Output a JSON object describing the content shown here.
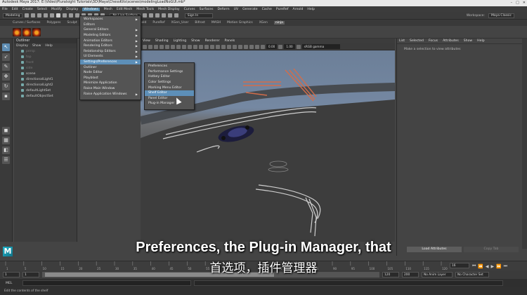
{
  "window": {
    "title": "Autodesk Maya 2017: E:\\Video\\Pluralsight Tutorials\\3D\\Maya\\ChessKits\\scenes\\modelingLoadNoGUI.mb*"
  },
  "menubar": [
    "File",
    "Edit",
    "Create",
    "Select",
    "Modify",
    "Display",
    "Windows",
    "Mesh",
    "Edit Mesh",
    "Mesh Tools",
    "Mesh Display",
    "Curves",
    "Surfaces",
    "Deform",
    "UV",
    "Generate",
    "Cache",
    "PureRef",
    "Arnold",
    "Help"
  ],
  "menubar_active": "Windows",
  "status_line": {
    "mode": "Modeling",
    "live_surface": "No Live Surface",
    "sign_in": "Sign In",
    "workspace_label": "Workspace:",
    "workspace_value": "Maya Classic"
  },
  "shelf_tabs": [
    "Curves / Surfaces",
    "Polygons",
    "Sculpt",
    "FX",
    "FX Caching",
    "Custom",
    "Arnold",
    "PureRef",
    "XGen_User",
    "Bifrost",
    "MASH",
    "Motion Graphics",
    "XGen",
    "ninja"
  ],
  "shelf_tab_active": "ninja",
  "outliner": {
    "title": "Outliner",
    "menu": [
      "Display",
      "Show",
      "Help"
    ],
    "items": [
      {
        "label": "persp",
        "dim": true
      },
      {
        "label": "top",
        "dim": true
      },
      {
        "label": "front",
        "dim": true
      },
      {
        "label": "side",
        "dim": true
      },
      {
        "label": "scene",
        "dim": false
      },
      {
        "label": "directionalLight1",
        "dim": false
      },
      {
        "label": "directionalLight2",
        "dim": false
      },
      {
        "label": "defaultLightSet",
        "dim": false
      },
      {
        "label": "defaultObjectSet",
        "dim": false
      }
    ]
  },
  "windows_menu": {
    "items": [
      {
        "label": "Workspaces",
        "arrow": true,
        "highlight": false
      },
      {
        "label": "Editors",
        "arrow": false,
        "highlight": false
      },
      {
        "label": "General Editors",
        "arrow": true,
        "highlight": false
      },
      {
        "label": "Modeling Editors",
        "arrow": true,
        "highlight": false
      },
      {
        "label": "Animation Editors",
        "arrow": true,
        "highlight": false
      },
      {
        "label": "Rendering Editors",
        "arrow": true,
        "highlight": false
      },
      {
        "label": "Relationship Editors",
        "arrow": true,
        "highlight": false
      },
      {
        "label": "UI Elements",
        "arrow": true,
        "highlight": false
      },
      {
        "label": "Settings/Preferences",
        "arrow": true,
        "highlight": true
      },
      {
        "label": "Outliner",
        "arrow": false,
        "highlight": false
      },
      {
        "label": "Node Editor",
        "arrow": false,
        "highlight": false
      },
      {
        "label": "Playblast",
        "arrow": false,
        "highlight": false
      },
      {
        "label": "Minimize Application",
        "arrow": false,
        "highlight": false
      },
      {
        "label": "Raise Main Window",
        "arrow": false,
        "highlight": false
      },
      {
        "label": "Raise Application Windows",
        "arrow": true,
        "highlight": false
      }
    ]
  },
  "settings_submenu": {
    "items": [
      {
        "label": "Preferences",
        "highlight": false
      },
      {
        "label": "Performance Settings",
        "highlight": false
      },
      {
        "label": "Hotkey Editor",
        "highlight": false
      },
      {
        "label": "Color Settings",
        "highlight": false
      },
      {
        "label": "Marking Menu Editor",
        "highlight": false
      },
      {
        "label": "Shelf Editor",
        "highlight": true
      },
      {
        "label": "Panel Editor",
        "highlight": false
      },
      {
        "label": "Plug-in Manager",
        "highlight": false
      }
    ]
  },
  "viewport": {
    "menu": [
      "View",
      "Shading",
      "Lighting",
      "Show",
      "Renderer",
      "Panels"
    ],
    "value_a": "0.00",
    "value_b": "1.00",
    "color_space": "sRGB gamma"
  },
  "attribute_editor": {
    "menu": [
      "List",
      "Selected",
      "Focus",
      "Attributes",
      "Show",
      "Help"
    ],
    "message": "Make a selection to view attributes",
    "load_button": "Load Attributes",
    "copy_button": "Copy Tab"
  },
  "timeline": {
    "ticks": [
      "1",
      "5",
      "10",
      "15",
      "20",
      "25",
      "30",
      "35",
      "40",
      "45",
      "50",
      "55",
      "60",
      "65",
      "70",
      "75",
      "80",
      "85",
      "90",
      "95",
      "100",
      "105",
      "110",
      "115",
      "120"
    ],
    "current_frame": "16"
  },
  "range": {
    "start": "1",
    "start_inner": "1",
    "slider_label": "120",
    "end_inner": "120",
    "end": "200",
    "anim_layer": "No Anim Layer",
    "char_set": "No Character Set"
  },
  "mel": {
    "label": "MEL"
  },
  "help_line": "Edit the contents of the shelf",
  "subtitles": {
    "english": "Preferences, the Plug-in Manager, that",
    "chinese": "首选项，插件管理器"
  },
  "colors": {
    "highlight": "#5d8fb8",
    "accent_dark": "#2b2b2b"
  }
}
